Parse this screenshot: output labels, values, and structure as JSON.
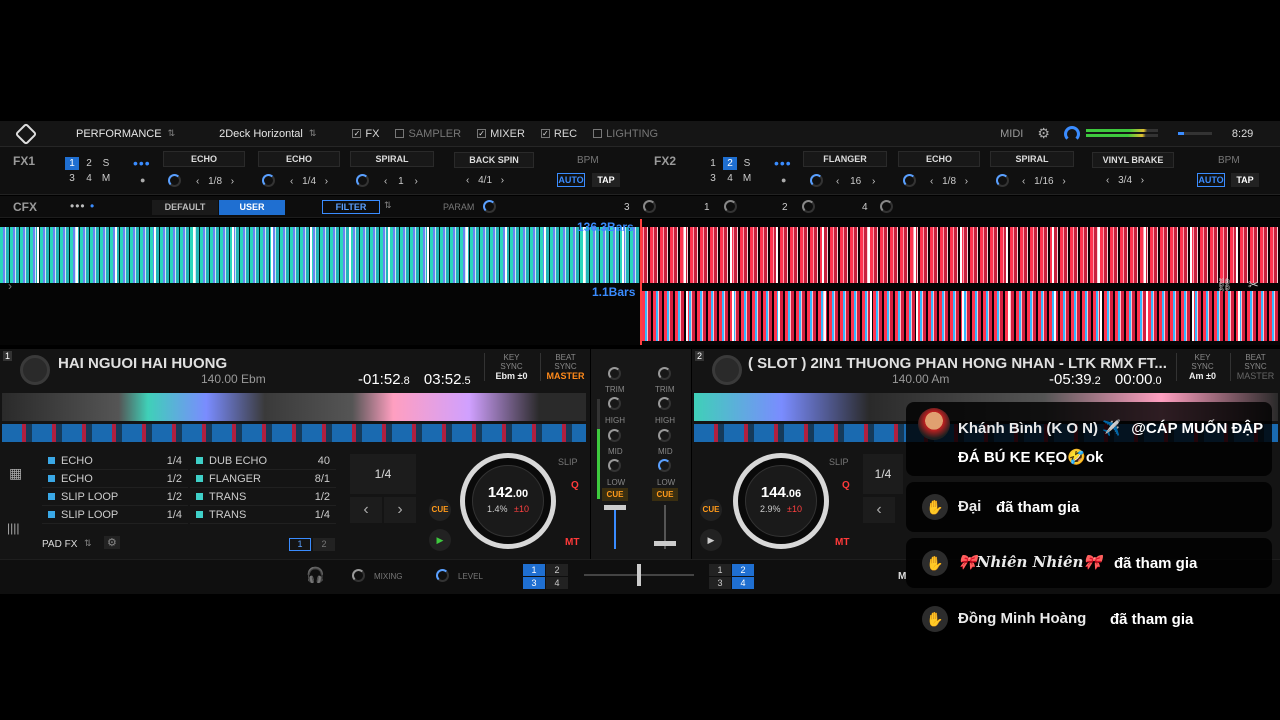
{
  "topbar": {
    "mode": "PERFORMANCE",
    "layout": "2Deck Horizontal",
    "fx": "FX",
    "sampler": "SAMPLER",
    "mixer": "MIXER",
    "rec": "REC",
    "lighting": "LIGHTING",
    "midi": "MIDI",
    "clock": "8:29",
    "check": "✓"
  },
  "fx1": {
    "label": "FX1",
    "deck_buttons": [
      "1",
      "2",
      "S",
      "3",
      "4",
      "M"
    ],
    "slots": [
      {
        "name": "ECHO",
        "value": "1/8"
      },
      {
        "name": "ECHO",
        "value": "1/4"
      },
      {
        "name": "SPIRAL",
        "value": "1"
      }
    ],
    "beat_fx": {
      "name": "BACK SPIN",
      "value": "4/1"
    },
    "bpm_label": "BPM",
    "auto": "AUTO",
    "tap": "TAP"
  },
  "fx2": {
    "label": "FX2",
    "deck_buttons": [
      "1",
      "2",
      "S",
      "3",
      "4",
      "M"
    ],
    "slots": [
      {
        "name": "FLANGER",
        "value": "16"
      },
      {
        "name": "ECHO",
        "value": "1/8"
      },
      {
        "name": "SPIRAL",
        "value": "1/16"
      }
    ],
    "beat_fx": {
      "name": "VINYL BRAKE",
      "value": "3/4"
    },
    "bpm_label": "BPM",
    "auto": "AUTO",
    "tap": "TAP"
  },
  "cfx": {
    "label": "CFX",
    "default": "DEFAULT",
    "user": "USER",
    "filter": "FILTER",
    "param": "PARAM",
    "knob_labels": [
      "3",
      "1",
      "2",
      "4"
    ]
  },
  "waveform": {
    "deck1_bars": "136.3Bars",
    "deck2_bars": "1.1Bars"
  },
  "deck1": {
    "number": "1",
    "title": "HAI NGUOI HAI HUONG",
    "bpm_key": "140.00 Ebm",
    "remain": "-01:52",
    "remain_dec": ".8",
    "total": "03:52",
    "total_dec": ".5",
    "key_sync": "KEY SYNC",
    "key_val": "Ebm ±0",
    "beat_sync": "BEAT SYNC",
    "master": "MASTER",
    "pad_fx": [
      {
        "name": "ECHO",
        "val": "1/4",
        "color": "#3aa8e6"
      },
      {
        "name": "ECHO",
        "val": "1/2",
        "color": "#3aa8e6"
      },
      {
        "name": "SLIP LOOP",
        "val": "1/2",
        "color": "#3aa8e6"
      },
      {
        "name": "SLIP LOOP",
        "val": "1/4",
        "color": "#3aa8e6"
      }
    ],
    "pad_fx2": [
      {
        "name": "DUB ECHO",
        "val": "40",
        "color": "#3fd0c8"
      },
      {
        "name": "FLANGER",
        "val": "8/1",
        "color": "#3fd0c8"
      },
      {
        "name": "TRANS",
        "val": "1/2",
        "color": "#3fd0c8"
      },
      {
        "name": "TRANS",
        "val": "1/4",
        "color": "#3fd0c8"
      }
    ],
    "pad_fx_label": "PAD FX",
    "pages": [
      "1",
      "2"
    ],
    "loop": "1/4",
    "bpm_big": "142",
    "bpm_dec": ".00",
    "pitch": "1.4%",
    "range": "±10",
    "slip": "SLIP",
    "q": "Q",
    "cue": "CUE",
    "play": "▶",
    "mt": "MT"
  },
  "deck2": {
    "number": "2",
    "title": "( SLOT ) 2IN1 THUONG PHAN HONG NHAN - LTK RMX FT...",
    "bpm_key": "140.00 Am",
    "remain": "-05:39",
    "remain_dec": ".2",
    "total": "00:00",
    "total_dec": ".0",
    "key_sync": "KEY SYNC",
    "key_val": "Am ±0",
    "beat_sync": "BEAT SYNC",
    "master": "MASTER",
    "loop": "1/4",
    "bpm_big": "144",
    "bpm_dec": ".06",
    "pitch": "2.9%",
    "range": "±10",
    "slip": "SLIP",
    "q": "Q",
    "cue": "CUE",
    "play": "▶",
    "mt": "MT"
  },
  "mixer": {
    "trim": "TRIM",
    "high": "HIGH",
    "mid": "MID",
    "low": "LOW",
    "cue": "CUE"
  },
  "bottom": {
    "mixing": "MIXING",
    "level": "LEVEL",
    "left_nums": [
      "1",
      "2",
      "3",
      "4"
    ],
    "right_nums": [
      "1",
      "2",
      "3",
      "4"
    ],
    "m": "M"
  },
  "chat": [
    {
      "name": "Khánh Bình (K O N) ✈️",
      "text": "@CÁP MUỐN ĐẬP ĐÁ BÚ KE KẸO🤣ok",
      "avatar": "avatar"
    },
    {
      "name": "Đại",
      "text": "đã tham gia",
      "avatar": "wave-hand"
    },
    {
      "name": "🎀𝑵𝒉𝒊𝒆̂𝒏 𝑵𝒉𝒊𝒆̂𝒏🎀",
      "text": "đã tham gia",
      "avatar": "wave-hand"
    },
    {
      "name": "Đồng Minh Hoàng",
      "text": "đã tham gia",
      "avatar": "wave-hand"
    }
  ],
  "colors": {
    "accent": "#1f6fd1",
    "deck1_wave": "#3fe0c8",
    "deck2_wave": "#ff3a5a"
  }
}
